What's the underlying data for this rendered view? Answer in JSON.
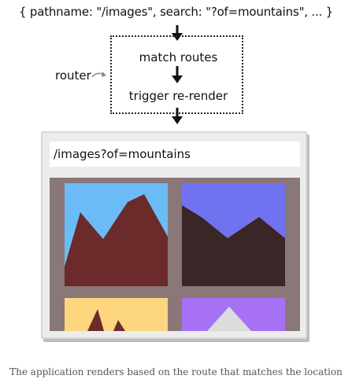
{
  "diagram": {
    "location": "{ pathname: \"/images\", search: \"?of=mountains\", ... }",
    "router_label": "router",
    "steps": [
      "match routes",
      "trigger re-render"
    ]
  },
  "browser": {
    "url": "/images?of=mountains",
    "images": [
      {
        "sky": "#6bbcf6",
        "mountain": "#6b2b2b",
        "peak": null
      },
      {
        "sky": "#7172f0",
        "mountain": "#3a2626",
        "peak": null
      },
      {
        "sky": "#fdd67f",
        "mountain": "#6b2b2b",
        "peak": null
      },
      {
        "sky": "#a771f5",
        "mountain": "#a771f5",
        "peak": "#dcdcdc"
      }
    ]
  },
  "caption": "The application renders based on the route that matches the location"
}
